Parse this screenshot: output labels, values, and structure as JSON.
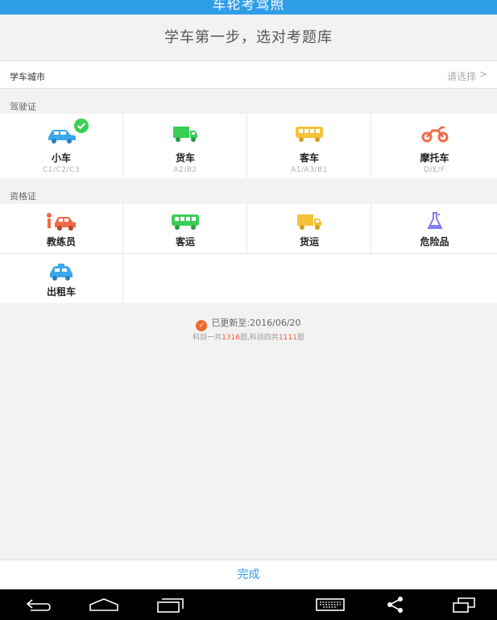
{
  "titlebar": {
    "title": "车轮考驾照"
  },
  "heading": "学车第一步，选对考题库",
  "city": {
    "label": "学车城市",
    "value": "请选择",
    "chevron": ">"
  },
  "sections": {
    "license": {
      "label": "驾驶证",
      "items": [
        {
          "name": "小车",
          "code": "C1/C2/C3",
          "icon": "car-icon",
          "color": "#3da7ec",
          "selected": true
        },
        {
          "name": "货车",
          "code": "A2/B2",
          "icon": "truck-icon",
          "color": "#3bcf56"
        },
        {
          "name": "客车",
          "code": "A1/A3/B1",
          "icon": "bus-icon",
          "color": "#f5c23a"
        },
        {
          "name": "摩托车",
          "code": "D/E/F",
          "icon": "motorcycle-icon",
          "color": "#f06a4a"
        }
      ]
    },
    "qualification": {
      "label": "资格证",
      "items": [
        {
          "name": "教练员",
          "icon": "instructor-icon",
          "color": "#f06a4a"
        },
        {
          "name": "客运",
          "icon": "bus-icon",
          "color": "#3bcf56"
        },
        {
          "name": "货运",
          "icon": "truck-icon",
          "color": "#f5c23a"
        },
        {
          "name": "危险品",
          "icon": "flask-icon",
          "color": "#7f7df0"
        },
        {
          "name": "出租车",
          "icon": "taxi-icon",
          "color": "#3da7ec"
        }
      ]
    }
  },
  "update": {
    "text": "已更新至:2016/06/20",
    "stats_prefix": "科目一共",
    "subject1_count": "1316",
    "stats_mid": "题,科目四共",
    "subject4_count": "1111",
    "stats_suffix": "题"
  },
  "footer": {
    "done_label": "完成"
  },
  "navbar": [
    "back-icon",
    "home-icon",
    "recents-icon",
    "keyboard-icon",
    "share-icon",
    "screen-icon"
  ],
  "colors": {
    "accent": "#2f9ee8",
    "check": "#3bcf56",
    "highlight": "#f05a3a"
  }
}
